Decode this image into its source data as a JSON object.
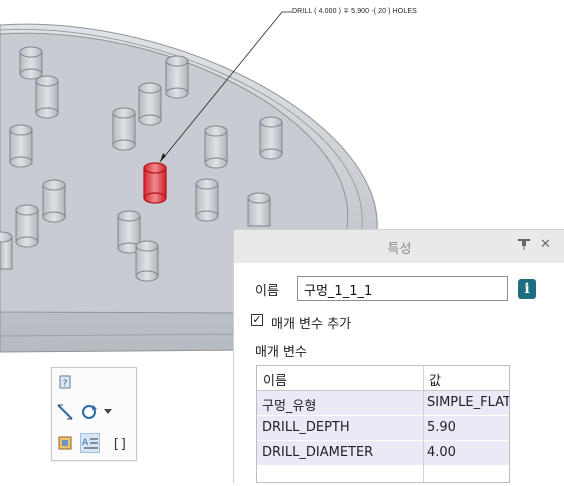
{
  "annotation": {
    "leader_text": "DRILL ( 4.000 ) ∓ 5.900 -( 20 ) HOLES"
  },
  "mini_toolbar": {
    "items": [
      {
        "name": "info-pin-icon"
      },
      {
        "name": "dimension-icon"
      },
      {
        "name": "rotate-icon"
      },
      {
        "name": "dropdown-chevron-icon"
      },
      {
        "name": "model-view-icon"
      },
      {
        "name": "text-align-icon"
      },
      {
        "name": "brackets-icon"
      }
    ]
  },
  "properties_panel": {
    "title": "특성",
    "pin_icon": "pin-icon",
    "close_icon": "close-icon",
    "name_label": "이름",
    "name_value": "구멍_1_1_1",
    "info_icon_glyph": "i",
    "add_param_checked": true,
    "add_param_label": "매개 변수 추가",
    "params_label": "매개 변수",
    "table": {
      "columns": [
        "이름",
        "값"
      ],
      "rows": [
        [
          "구멍_유형",
          "SIMPLE_FLAT"
        ],
        [
          "DRILL_DEPTH",
          "5.90"
        ],
        [
          "DRILL_DIAMETER",
          "4.00"
        ]
      ]
    }
  },
  "colors": {
    "part_gray": "#c5c9cf",
    "selected_red": "#e0333b",
    "panel_header": "#e9e9e9",
    "row_highlight": "#ece9f7",
    "info_button": "#1b6f7e"
  }
}
